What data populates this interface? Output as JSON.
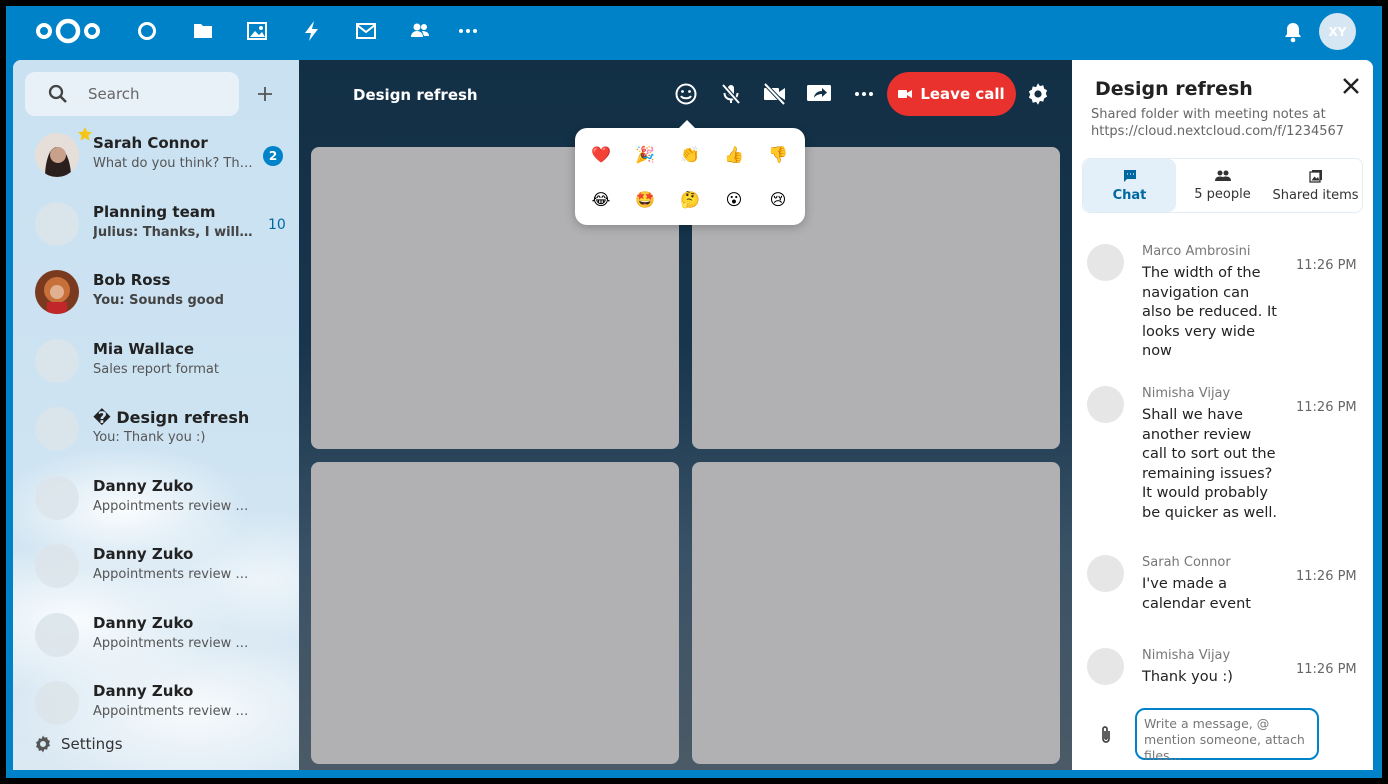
{
  "app": {
    "top_apps": [
      "dashboard-icon",
      "files-icon",
      "photos-icon",
      "activity-icon",
      "mail-icon",
      "contacts-icon",
      "more-icon"
    ],
    "avatar_initials": "XY",
    "accent": "#0082c9"
  },
  "sidebar": {
    "search_placeholder": "Search",
    "conversations": [
      {
        "name": "Sarah Connor",
        "message": "What do you think? There...",
        "badge": "2",
        "favorite": true
      },
      {
        "name": "Planning team",
        "message": "Julius: Thanks, I will let...",
        "badge": "10"
      },
      {
        "name": "Bob Ross",
        "message": "You: Sounds good"
      },
      {
        "name": "Mia Wallace",
        "message": "Sales report format"
      },
      {
        "name": "� Design refresh",
        "message": "You: Thank you :)"
      },
      {
        "name": "Danny Zuko",
        "message": "Appointments review call"
      },
      {
        "name": "Danny Zuko",
        "message": "Appointments review call"
      },
      {
        "name": "Danny Zuko",
        "message": "Appointments review call"
      },
      {
        "name": "Danny Zuko",
        "message": "Appointments review call"
      }
    ],
    "settings_label": "Settings"
  },
  "call": {
    "title": "Design refresh",
    "leave_label": "Leave call",
    "leave_color": "#e9322d",
    "reactions": [
      "❤️",
      "🎉",
      "👏",
      "👍",
      "👎",
      "😂",
      "🤩",
      "🤔",
      "😮",
      "😢"
    ]
  },
  "panel": {
    "title": "Design refresh",
    "description": "Shared folder with meeting notes at https://cloud.nextcloud.com/f/1234567",
    "tabs": [
      {
        "label": "Chat",
        "icon": "chat-icon"
      },
      {
        "label": "5 people",
        "icon": "people-icon"
      },
      {
        "label": "Shared items",
        "icon": "shared-items-icon"
      }
    ],
    "messages": [
      {
        "author": "Marco Ambrosini",
        "text": "The width of the navigation can also be reduced. It looks very wide now",
        "time": "11:26 PM"
      },
      {
        "author": "Nimisha Vijay",
        "text": "Shall we have another review call to sort out the remaining issues? It would probably be quicker as well.",
        "time": "11:26 PM"
      },
      {
        "author": "Sarah Connor",
        "text": "I've made a calendar event",
        "time": "11:26 PM"
      },
      {
        "author": "Nimisha Vijay",
        "text": "Thank you :)",
        "time": "11:26 PM"
      }
    ],
    "compose_placeholder": "Write a message, @ mention someone, attach files..."
  }
}
